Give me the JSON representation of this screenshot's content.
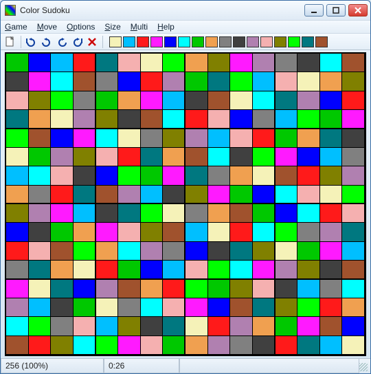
{
  "window": {
    "title": "Color Sudoku"
  },
  "menu": [
    {
      "label": "Game",
      "hotkey_index": 0
    },
    {
      "label": "Move",
      "hotkey_index": 0
    },
    {
      "label": "Options",
      "hotkey_index": 0
    },
    {
      "label": "Size",
      "hotkey_index": 0
    },
    {
      "label": "Multi",
      "hotkey_index": 0
    },
    {
      "label": "Help",
      "hotkey_index": 0
    }
  ],
  "toolbar_icons": [
    "new",
    "undo-all",
    "undo",
    "redo",
    "redo-all",
    "delete"
  ],
  "palette": [
    "#f5f2b8",
    "#00bfff",
    "#ff1a1a",
    "#ff1aff",
    "#0000ff",
    "#00ffff",
    "#00c800",
    "#f0a050",
    "#808080",
    "#404040",
    "#b080b0",
    "#f5b0b0",
    "#808000",
    "#00ff00",
    "#007880",
    "#a0522d"
  ],
  "status": {
    "left": "256  (100%)",
    "center": "0:26",
    "right": ""
  },
  "grid": {
    "size": 16,
    "block_size": 4
  },
  "board": [
    [
      6,
      4,
      1,
      2,
      14,
      11,
      0,
      13,
      7,
      12,
      3,
      10,
      8,
      9,
      5,
      15
    ],
    [
      9,
      3,
      5,
      15,
      8,
      4,
      2,
      10,
      6,
      14,
      13,
      1,
      11,
      0,
      7,
      12
    ],
    [
      11,
      12,
      13,
      8,
      6,
      7,
      3,
      1,
      9,
      15,
      0,
      5,
      14,
      10,
      4,
      2
    ],
    [
      14,
      7,
      0,
      10,
      12,
      9,
      15,
      5,
      2,
      11,
      4,
      8,
      1,
      13,
      6,
      3
    ],
    [
      13,
      15,
      4,
      3,
      5,
      0,
      8,
      12,
      10,
      1,
      11,
      2,
      6,
      7,
      14,
      9
    ],
    [
      0,
      6,
      10,
      12,
      11,
      2,
      14,
      7,
      15,
      5,
      9,
      13,
      3,
      4,
      1,
      8
    ],
    [
      1,
      5,
      11,
      9,
      4,
      13,
      6,
      3,
      14,
      8,
      7,
      0,
      15,
      2,
      12,
      10
    ],
    [
      7,
      8,
      2,
      14,
      15,
      10,
      1,
      9,
      12,
      3,
      6,
      4,
      5,
      11,
      0,
      13
    ],
    [
      12,
      10,
      3,
      1,
      9,
      14,
      13,
      0,
      8,
      7,
      15,
      6,
      4,
      5,
      2,
      11
    ],
    [
      4,
      9,
      6,
      7,
      3,
      11,
      12,
      15,
      1,
      0,
      2,
      5,
      13,
      8,
      10,
      14
    ],
    [
      2,
      11,
      15,
      13,
      7,
      5,
      10,
      8,
      4,
      9,
      14,
      12,
      0,
      6,
      3,
      1
    ],
    [
      8,
      14,
      7,
      0,
      2,
      6,
      4,
      1,
      11,
      13,
      5,
      3,
      10,
      12,
      9,
      15
    ],
    [
      3,
      0,
      14,
      4,
      10,
      15,
      7,
      2,
      13,
      6,
      12,
      11,
      9,
      1,
      8,
      5
    ],
    [
      10,
      1,
      9,
      6,
      0,
      8,
      5,
      11,
      3,
      4,
      15,
      14,
      12,
      13,
      2,
      7
    ],
    [
      5,
      13,
      8,
      11,
      1,
      12,
      9,
      14,
      0,
      2,
      10,
      7,
      6,
      3,
      15,
      4
    ],
    [
      15,
      2,
      12,
      5,
      13,
      3,
      11,
      6,
      7,
      10,
      8,
      9,
      2,
      14,
      1,
      0
    ]
  ]
}
